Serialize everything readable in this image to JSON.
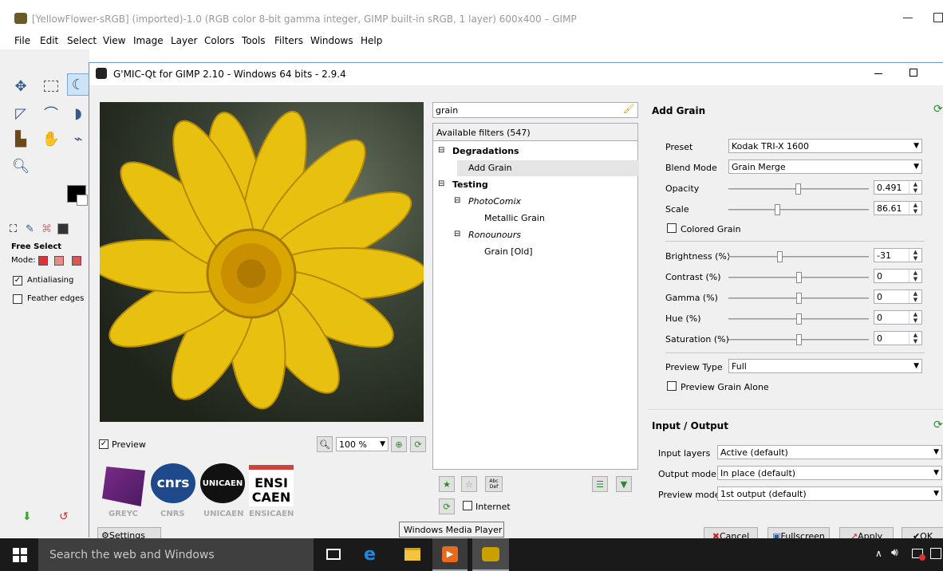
{
  "gimp": {
    "title": "[YellowFlower-sRGB] (imported)-1.0 (RGB color 8-bit gamma integer, GIMP built-in sRGB, 1 layer) 600x400 – GIMP",
    "menu": [
      "File",
      "Edit",
      "Select",
      "View",
      "Image",
      "Layer",
      "Colors",
      "Tools",
      "Filters",
      "Windows",
      "Help"
    ],
    "tool_options": {
      "title": "Free Select",
      "mode_label": "Mode:",
      "antialiasing": "Antialiasing",
      "feather": "Feather edges"
    }
  },
  "gmic": {
    "title": "G'MIC-Qt for GIMP 2.10 - Windows 64 bits - 2.9.4",
    "preview": {
      "checkbox_label": "Preview",
      "zoom": "100 %"
    },
    "logos": [
      "GREYC",
      "CNRS",
      "UNICAEN",
      "ENSICAEN"
    ],
    "logo_marks": {
      "cnrs": "cnrs",
      "unicaen": "UNICAEN",
      "ensi": "ENSI",
      "caen": "CAEN"
    },
    "search": {
      "value": "grain"
    },
    "filters": {
      "header": "Available filters (547)",
      "tree": [
        {
          "label": "Degradations",
          "bold": true
        },
        {
          "label": "Add Grain",
          "bold": false,
          "selected": true
        },
        {
          "label": "Testing",
          "bold": true
        },
        {
          "label": "PhotoComix",
          "italic": true
        },
        {
          "label": "Metallic Grain"
        },
        {
          "label": "Ronounours",
          "italic": true
        },
        {
          "label": "Grain [Old]"
        }
      ],
      "internet_label": "Internet"
    },
    "settings": {
      "title": "Add Grain",
      "preset_label": "Preset",
      "preset_value": "Kodak TRI-X 1600",
      "blend_label": "Blend Mode",
      "blend_value": "Grain Merge",
      "opacity_label": "Opacity",
      "opacity_value": "0.491",
      "scale_label": "Scale",
      "scale_value": "86.61",
      "colored_grain": "Colored Grain",
      "brightness_label": "Brightness (%)",
      "brightness_value": "-31",
      "contrast_label": "Contrast (%)",
      "contrast_value": "0",
      "gamma_label": "Gamma (%)",
      "gamma_value": "0",
      "hue_label": "Hue (%)",
      "hue_value": "0",
      "saturation_label": "Saturation (%)",
      "saturation_value": "0",
      "preview_type_label": "Preview Type",
      "preview_type_value": "Full",
      "preview_grain_alone": "Preview Grain Alone"
    },
    "io": {
      "title": "Input / Output",
      "input_label": "Input layers",
      "input_value": "Active (default)",
      "output_label": "Output mode",
      "output_value": "In place (default)",
      "preview_label": "Preview mode",
      "preview_value": "1st output (default)"
    },
    "buttons": {
      "settings": "Settings",
      "cancel": "Cancel",
      "fullscreen": "Fullscreen",
      "apply": "Apply",
      "ok": "OK"
    }
  },
  "tooltip": "Windows Media Player",
  "taskbar": {
    "search_placeholder": "Search the web and Windows"
  },
  "colors": {
    "accent": "#3daee9",
    "selection": "#e5e5e5",
    "taskbar": "#1a1a1a"
  }
}
